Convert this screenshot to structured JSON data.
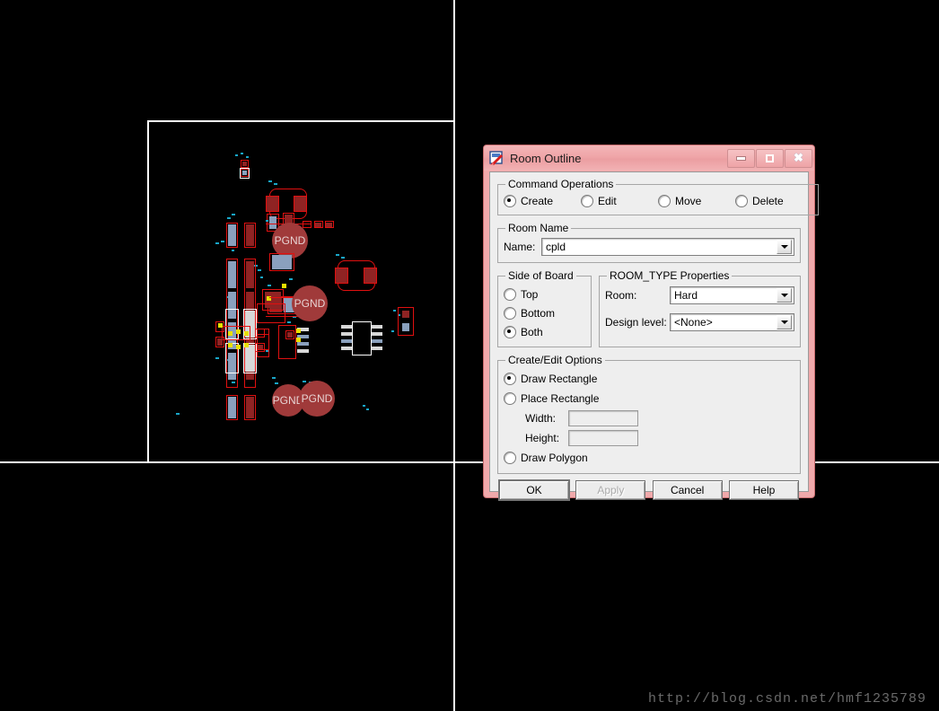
{
  "window": {
    "title": "Room Outline",
    "icon": "room-outline-icon",
    "controls": {
      "minimize": "minimize-icon",
      "maximize": "maximize-icon",
      "close": "close-icon"
    }
  },
  "command_operations": {
    "legend": "Command Operations",
    "options": [
      {
        "label": "Create",
        "selected": true
      },
      {
        "label": "Edit",
        "selected": false
      },
      {
        "label": "Move",
        "selected": false
      },
      {
        "label": "Delete",
        "selected": false
      }
    ]
  },
  "room_name": {
    "legend": "Room Name",
    "name_label": "Name:",
    "name_value": "cpld"
  },
  "side_of_board": {
    "legend": "Side of Board",
    "options": [
      {
        "label": "Top",
        "selected": false
      },
      {
        "label": "Bottom",
        "selected": false
      },
      {
        "label": "Both",
        "selected": true
      }
    ]
  },
  "room_type_properties": {
    "legend": "ROOM_TYPE Properties",
    "room_label": "Room:",
    "room_value": "Hard",
    "design_level_label": "Design level:",
    "design_level_value": "<None>"
  },
  "create_edit_options": {
    "legend": "Create/Edit Options",
    "options": [
      {
        "label": "Draw Rectangle",
        "selected": true
      },
      {
        "label": "Place Rectangle",
        "selected": false
      },
      {
        "label": "Draw Polygon",
        "selected": false
      }
    ],
    "width_label": "Width:",
    "width_value": "",
    "height_label": "Height:",
    "height_value": ""
  },
  "buttons": [
    {
      "label": "OK",
      "enabled": true
    },
    {
      "label": "Apply",
      "enabled": false
    },
    {
      "label": "Cancel",
      "enabled": true
    },
    {
      "label": "Help",
      "enabled": true
    }
  ],
  "canvas": {
    "background": "#000000",
    "board_outline_color": "#ffffff",
    "trace_color": "#19a6c8",
    "outline_color": "#e01010",
    "room_labels": [
      "PGND",
      "PGND",
      "PGND",
      "PGND"
    ]
  },
  "watermark": "http://blog.csdn.net/hmf1235789"
}
